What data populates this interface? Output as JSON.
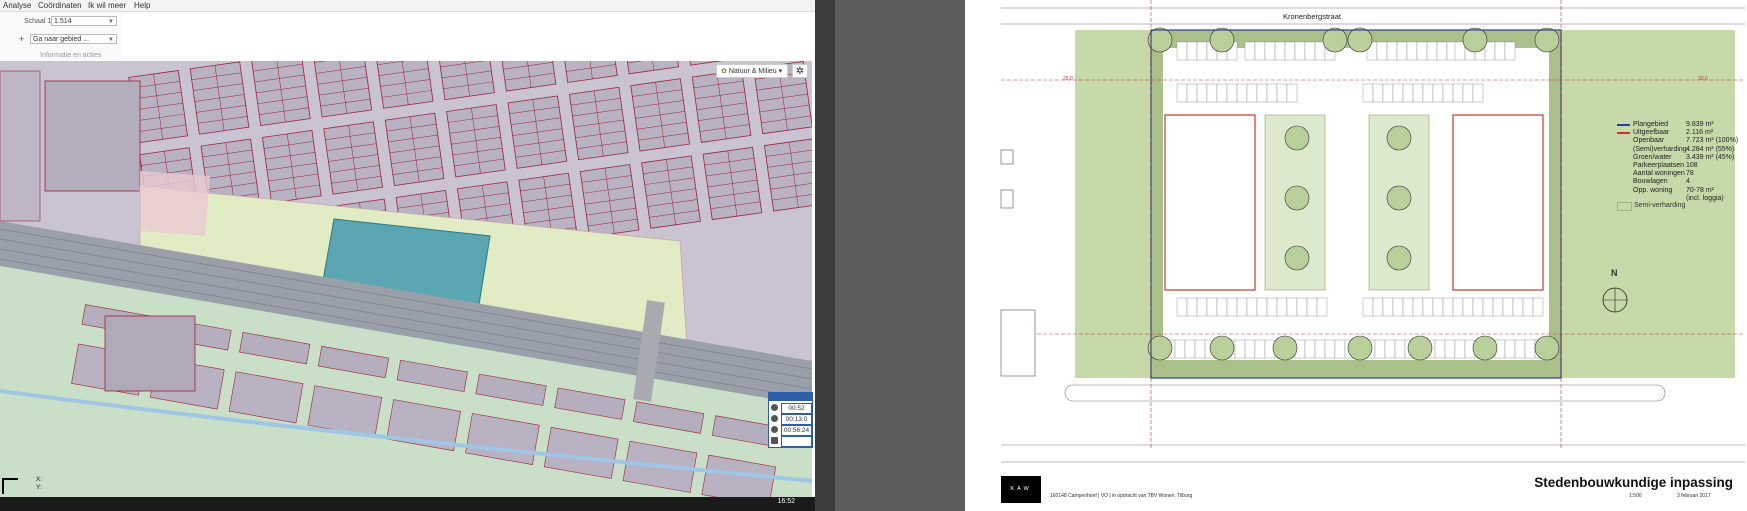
{
  "menu": [
    "Analyse",
    "Coördinaten",
    "Ik wil meer",
    "Help"
  ],
  "toolbar": {
    "scale_label": "Schaal 1:",
    "scale_value": "1.514",
    "goto_plus": "+",
    "goto_value": "Ga naar gebied ...",
    "info_label": "Informatie en acties"
  },
  "map": {
    "theme_button": "Natuur & Milieu",
    "coord_x_label": "X:",
    "coord_y_label": "Y:",
    "timers": [
      "00:52",
      "00:13:0",
      "00:56:24",
      ""
    ]
  },
  "taskbar": {
    "clock": "16:52"
  },
  "plan": {
    "street_label": "Kronenbergstraat",
    "legend": [
      {
        "key": "Plangebied",
        "value": "9.839 m²",
        "swatch": "#2a3d9e"
      },
      {
        "key": "Uitgeefbaar",
        "value": "2.116 m²",
        "swatch": "#c0392b"
      },
      {
        "key": "Openbaar",
        "value": "7.723 m² (100%)",
        "swatch": ""
      },
      {
        "key": "(Semi)verharding",
        "value": "4.284 m² (55%)",
        "swatch": ""
      },
      {
        "key": "Groen/water",
        "value": "3.439 m² (45%)",
        "swatch": ""
      },
      {
        "key": "Parkeerplaatsen",
        "value": "108",
        "swatch": ""
      },
      {
        "key": "Aantal woningen",
        "value": "78",
        "swatch": ""
      },
      {
        "key": "Bouwlagen",
        "value": "4",
        "swatch": ""
      },
      {
        "key": "Opp. woning",
        "value": "70-78 m²",
        "swatch": ""
      },
      {
        "key": "",
        "value": "(incl. loggia)",
        "swatch": ""
      }
    ],
    "semi_label": "Semi-verharding",
    "north_label": "N",
    "logo_text": "KAW",
    "project_info": "160148 Campenhoef | VO | in opdracht van TBV Wonen, Tilburg",
    "title": "Stedenbouwkundige inpassing",
    "scale": "1:500",
    "date": "3 februari 2017",
    "dim_left": "25.0",
    "dim_right": "30.0"
  },
  "colors": {
    "map_blocks": "#b9b2c3",
    "map_houses": "#c9c3d2",
    "plot_lines": "#9b2335",
    "highlight_plot": "#5aa7b3",
    "field_green": "#e2ecc4",
    "rail": "#9aa0aa",
    "plan_green": "#c6d9a8",
    "plan_boundary": "#2a3d9e",
    "plan_buildings": "#c0392b"
  }
}
